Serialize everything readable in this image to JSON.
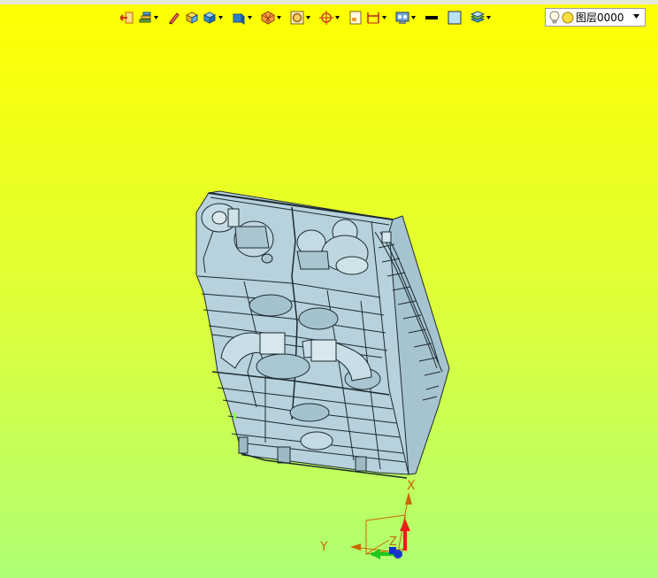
{
  "toolbar": {
    "items": [
      {
        "icon": "exit-sketch-icon",
        "has_dropdown": false
      },
      {
        "icon": "layer-settings-icon",
        "has_dropdown": true
      },
      {
        "icon": "pencil-edit-icon",
        "has_dropdown": false
      },
      {
        "icon": "solid-box-yellow-icon",
        "has_dropdown": false
      },
      {
        "icon": "solid-box-blue-icon",
        "has_dropdown": true
      },
      {
        "icon": "view-cube-icon",
        "has_dropdown": true
      },
      {
        "icon": "render-style-icon",
        "has_dropdown": true
      },
      {
        "icon": "zoom-fit-icon",
        "has_dropdown": true
      },
      {
        "icon": "snap-point-icon",
        "has_dropdown": true
      },
      {
        "icon": "sheet-icon",
        "has_dropdown": false
      },
      {
        "icon": "dimension-icon",
        "has_dropdown": true
      },
      {
        "icon": "display-settings-icon",
        "has_dropdown": true
      },
      {
        "icon": "line-color-icon",
        "has_dropdown": false
      },
      {
        "icon": "fill-color-icon",
        "has_dropdown": false
      },
      {
        "icon": "layers-stack-icon",
        "has_dropdown": true
      }
    ],
    "colors": {
      "line_color": "#000000",
      "fill_color": "#b9e3f2"
    }
  },
  "layer_combo": {
    "label": "图层0000"
  },
  "triad": {
    "x_label": "X",
    "y_label": "Y",
    "z_label": "Z"
  },
  "viewport": {
    "bg_top": "#ffff00",
    "bg_bottom": "#aeff74"
  }
}
